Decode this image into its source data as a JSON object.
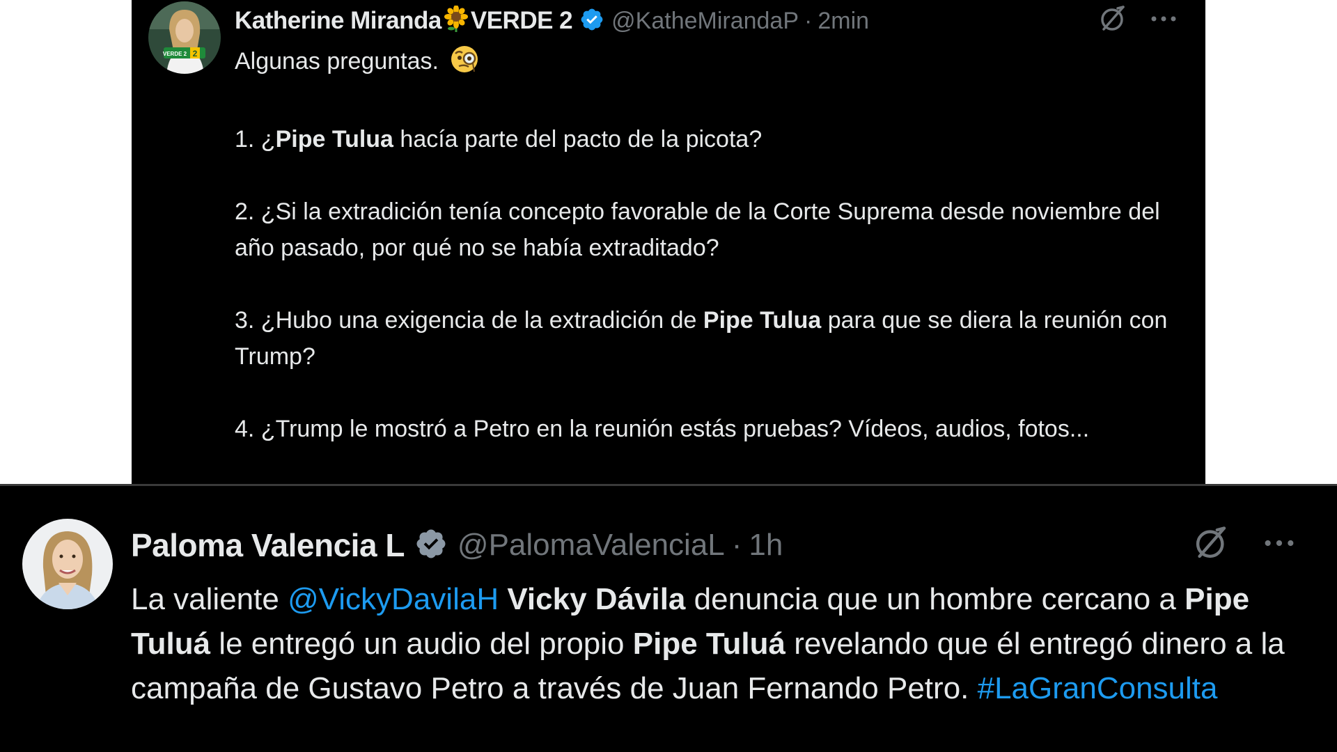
{
  "tweet1": {
    "author": {
      "name": "Katherine Miranda",
      "name_suffix": "VERDE 2",
      "handle": "@KatheMirandaP",
      "time": "2min",
      "avatar_badge": "VERDE 2"
    },
    "separator": "·",
    "body": {
      "intro": "Algunas preguntas.",
      "q1_num": "1. ¿",
      "q1_bold": "Pipe Tulua",
      "q1_rest": " hacía parte del pacto de la picota?",
      "q2": "2. ¿Si la extradición tenía concepto favorable de la Corte Suprema desde noviembre del año pasado, por qué no se había extraditado?",
      "q3_pre": "3. ¿Hubo una exigencia de la extradición de ",
      "q3_bold": "Pipe Tulua",
      "q3_post": " para que se diera la reunión con Trump?",
      "q4": "4. ¿Trump le mostró a Petro en la reunión estás pruebas? Vídeos, audios, fotos..."
    },
    "icons": [
      "grok-icon",
      "more-icon",
      "verified-icon",
      "sunflower-icon",
      "monocle-face-icon"
    ]
  },
  "tweet2": {
    "author": {
      "name": "Paloma Valencia L",
      "handle": "@PalomaValenciaL",
      "time": "1h"
    },
    "separator": "·",
    "body": {
      "t1": "La valiente ",
      "mention": "@VickyDavilaH",
      "t2": " ",
      "b1": "Vicky Dávila",
      "t3": " denuncia que un hombre cercano a ",
      "b2": "Pipe Tuluá",
      "t4": " le entregó un audio del propio ",
      "b3": "Pipe Tuluá",
      "t5": " revelando que él entregó dinero a la campaña de Gustavo Petro a través de Juan Fernando Petro. ",
      "hashtag": "#LaGranConsulta"
    },
    "icons": [
      "grok-icon",
      "more-icon",
      "verified-icon"
    ]
  },
  "colors": {
    "background": "#000000",
    "text": "#e7e9ea",
    "muted": "#71767b",
    "link": "#1d9bf0",
    "verified": "#1d9bf0"
  }
}
